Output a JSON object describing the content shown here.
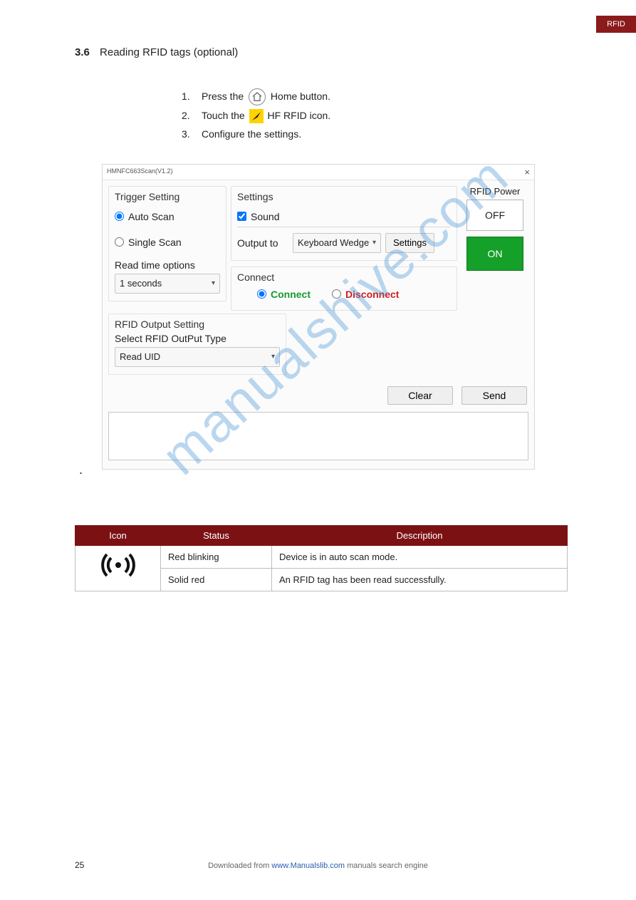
{
  "top_tab": "RFID",
  "section": {
    "num": "3.6",
    "title": "Reading RFID tags (optional)"
  },
  "steps": [
    {
      "n": "1.",
      "pre": "Press the ",
      "post_home": " Home button."
    },
    {
      "n": "2.",
      "pre": "Touch the ",
      "post_nav": " HF RFID icon."
    },
    {
      "n": "3.",
      "pre": "Configure the settings.",
      "post": ""
    }
  ],
  "window": {
    "title": "HMNFC663Scan(V1.2)",
    "trigger": {
      "legend": "Trigger Setting",
      "auto": "Auto Scan",
      "single": "Single Scan",
      "readtime_label": "Read time options",
      "readtime_value": "1 seconds"
    },
    "settings": {
      "legend": "Settings",
      "sound": "Sound",
      "output_to_label": "Output to",
      "output_to_value": "Keyboard Wedge",
      "settings_btn": "Settings"
    },
    "connect": {
      "legend": "Connect",
      "connect": "Connect",
      "disconnect": "Disconnect"
    },
    "power": {
      "legend": "RFID Power",
      "off": "OFF",
      "on": "ON"
    },
    "rfid_out": {
      "legend": "RFID Output Setting",
      "select_label": "Select RFID OutPut Type",
      "value": "Read UID"
    },
    "clear_btn": "Clear",
    "send_btn": "Send"
  },
  "watermark": "manualshive.com",
  "table": {
    "headers": [
      "Icon",
      "Status",
      "Description"
    ],
    "rows": [
      {
        "status": "Red blinking",
        "desc": "Device is in auto scan mode."
      },
      {
        "status": "Solid red",
        "desc": "An RFID tag has been read successfully."
      }
    ]
  },
  "page_num": "25",
  "footer": {
    "text": "Downloaded from ",
    "link_text": "www.Manualslib.com",
    "tail": " manuals search engine"
  }
}
